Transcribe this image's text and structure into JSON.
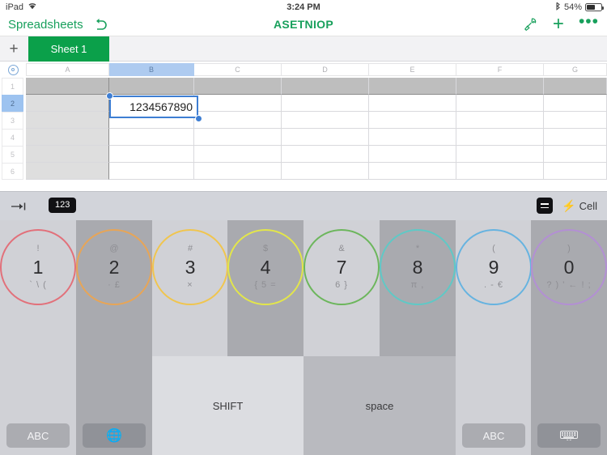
{
  "statusbar": {
    "device": "iPad",
    "wifi_icon": "wifi-icon",
    "time": "3:24 PM",
    "bluetooth_icon": "bluetooth-icon",
    "battery_percent": "54%"
  },
  "navbar": {
    "back_label": "Spreadsheets",
    "undo_icon": "undo-icon",
    "title": "ASETNIOP",
    "format_icon": "paint-roller-icon",
    "add_icon": "plus-icon",
    "more_icon": "ellipsis-icon"
  },
  "sheetbar": {
    "add_sheet_icon": "plus-icon",
    "tabs": [
      {
        "label": "Sheet 1",
        "active": true
      }
    ]
  },
  "spreadsheet": {
    "select_all_icon": "select-all-icon",
    "columns": [
      "A",
      "B",
      "C",
      "D",
      "E",
      "F",
      "G"
    ],
    "selected_column": "B",
    "rows": [
      "1",
      "2",
      "3",
      "4",
      "5",
      "6"
    ],
    "selected_row": "2",
    "active_cell": "B2",
    "active_cell_value": "1234567890"
  },
  "format_bar": {
    "tab_icon": "tab-indent-icon",
    "numeric_label": "123",
    "menu_icon": "list-menu-icon",
    "bolt_icon": "bolt-icon",
    "cell_label": "Cell"
  },
  "keyboard": {
    "keys": [
      {
        "top": "!",
        "main": "1",
        "bottom": "` \\ (",
        "color": "#e2707a",
        "shade": "light"
      },
      {
        "top": "@",
        "main": "2",
        "bottom": "· £",
        "color": "#e8a556",
        "shade": "dark"
      },
      {
        "top": "#",
        "main": "3",
        "bottom": "×",
        "color": "#f0c54e",
        "shade": "light"
      },
      {
        "top": "$",
        "main": "4",
        "bottom": "{ 5 =",
        "color": "#e3e64a",
        "shade": "dark"
      },
      {
        "top": "&",
        "main": "7",
        "bottom": "6 }",
        "color": "#6cb65c",
        "shade": "light"
      },
      {
        "top": "*",
        "main": "8",
        "bottom": "π ,",
        "color": "#5fc9c6",
        "shade": "dark"
      },
      {
        "top": "(",
        "main": "9",
        "bottom": ". - €",
        "color": "#66b3e0",
        "shade": "light"
      },
      {
        "top": ")",
        "main": "0",
        "bottom": "? ) ' ← ! ;",
        "color": "#b38fd4",
        "shade": "dark"
      }
    ],
    "shift_label": "SHIFT",
    "space_label": "space",
    "abc_left_label": "ABC",
    "globe_icon": "globe-icon",
    "abc_right_label": "ABC",
    "hide_keyboard_icon": "hide-keyboard-icon"
  },
  "colors": {
    "brand_green": "#18a05c",
    "tab_green": "#0ba04a",
    "selection_blue": "#3e7ed3",
    "header_blue": "#aecbf0"
  }
}
